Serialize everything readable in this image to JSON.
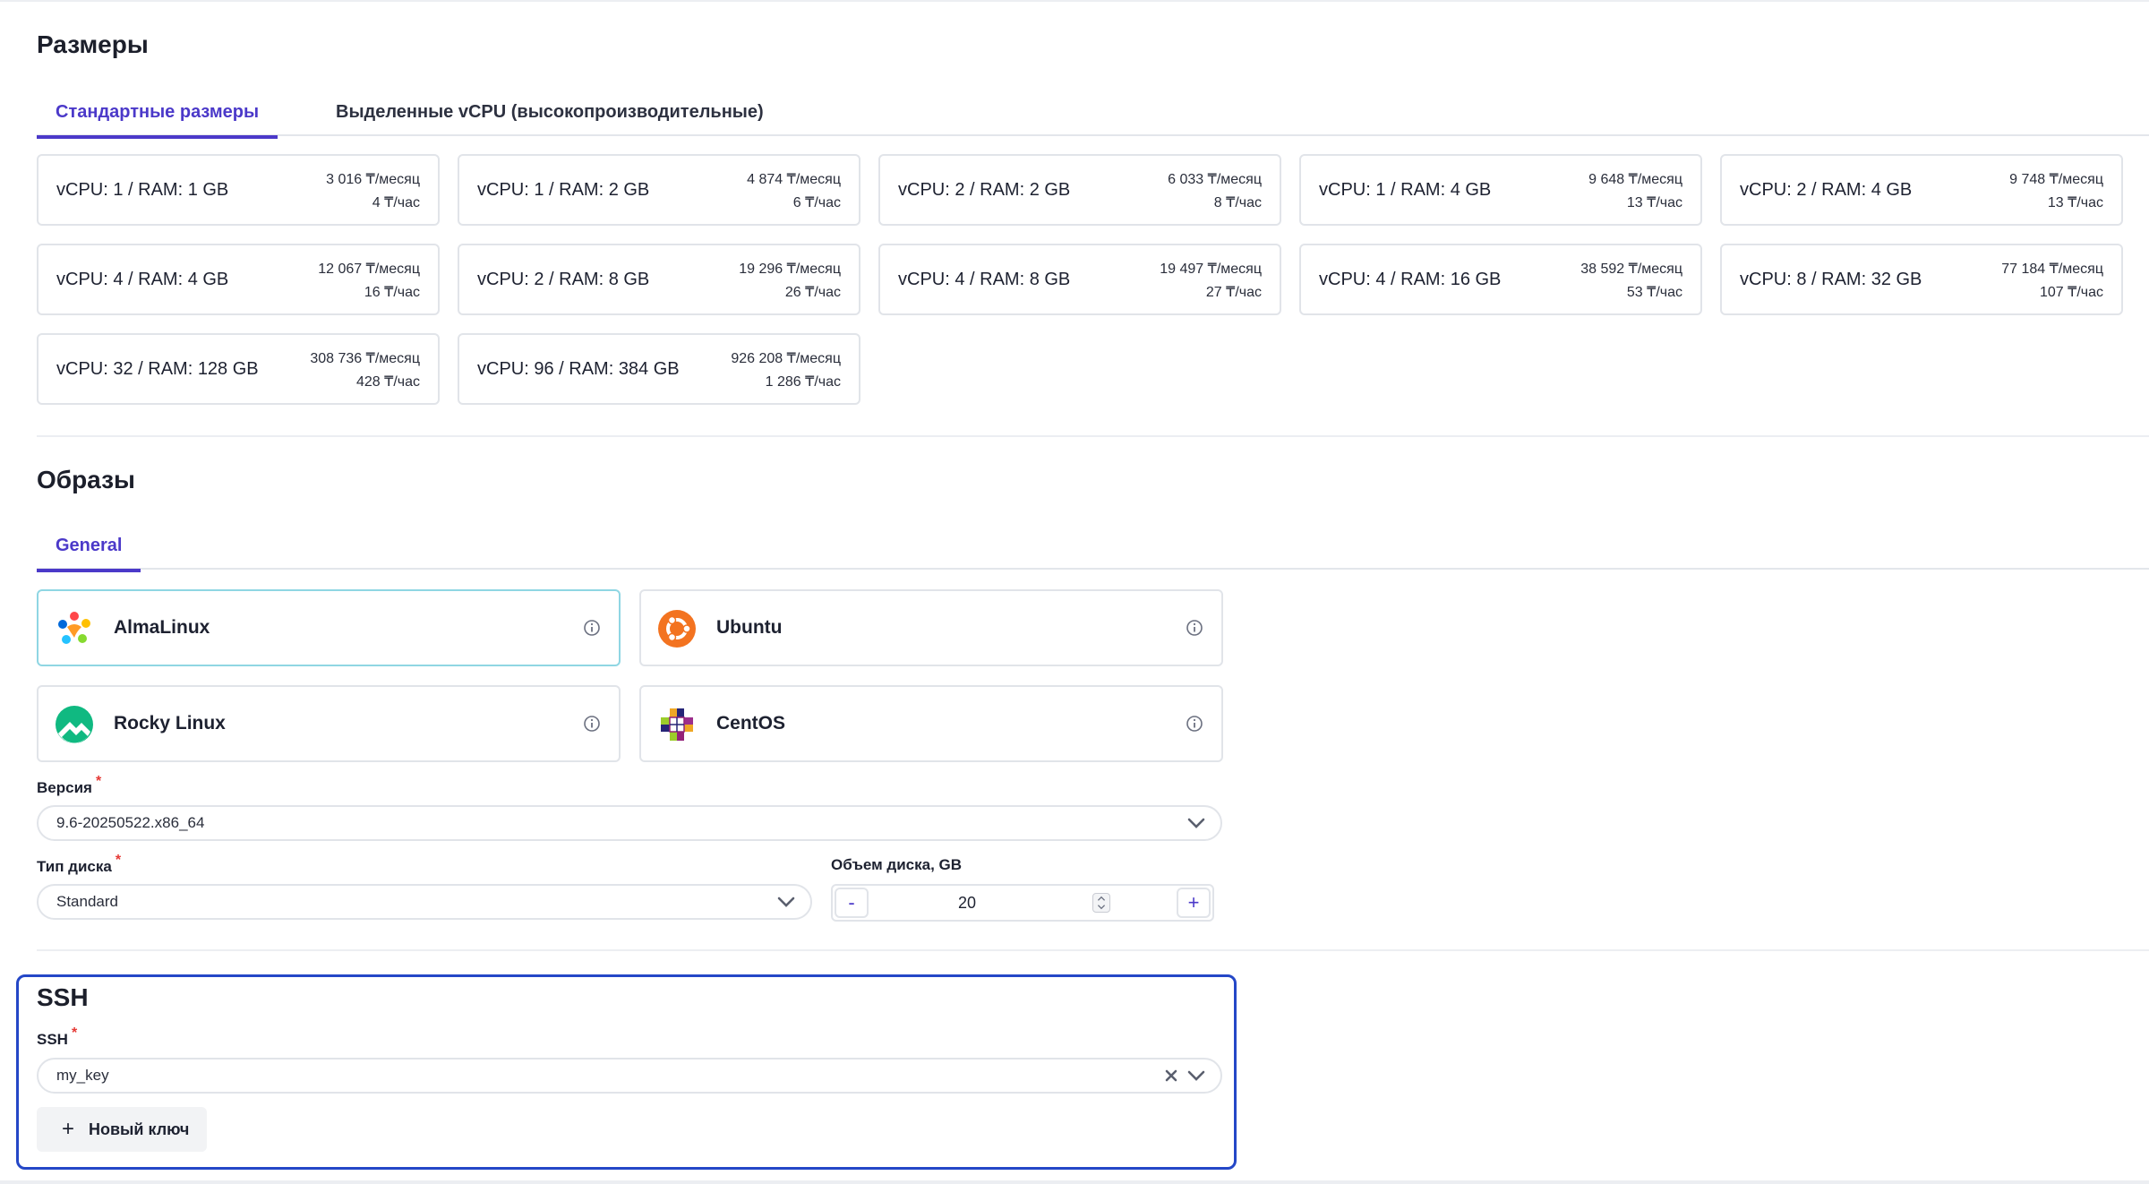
{
  "sizes": {
    "title": "Размеры",
    "tabs": [
      "Стандартные размеры",
      "Выделенные vCPU (высокопроизводительные)"
    ],
    "cards": [
      {
        "name": "vCPU: 1 / RAM: 1 GB",
        "monthly": "3 016 ₸/месяц",
        "hourly": "4 ₸/час"
      },
      {
        "name": "vCPU: 1 / RAM: 2 GB",
        "monthly": "4 874 ₸/месяц",
        "hourly": "6 ₸/час"
      },
      {
        "name": "vCPU: 2 / RAM: 2 GB",
        "monthly": "6 033 ₸/месяц",
        "hourly": "8 ₸/час"
      },
      {
        "name": "vCPU: 1 / RAM: 4 GB",
        "monthly": "9 648 ₸/месяц",
        "hourly": "13 ₸/час"
      },
      {
        "name": "vCPU: 2 / RAM: 4 GB",
        "monthly": "9 748 ₸/месяц",
        "hourly": "13 ₸/час"
      },
      {
        "name": "vCPU: 4 / RAM: 4 GB",
        "monthly": "12 067 ₸/месяц",
        "hourly": "16 ₸/час"
      },
      {
        "name": "vCPU: 2 / RAM: 8 GB",
        "monthly": "19 296 ₸/месяц",
        "hourly": "26 ₸/час"
      },
      {
        "name": "vCPU: 4 / RAM: 8 GB",
        "monthly": "19 497 ₸/месяц",
        "hourly": "27 ₸/час"
      },
      {
        "name": "vCPU: 4 / RAM: 16 GB",
        "monthly": "38 592 ₸/месяц",
        "hourly": "53 ₸/час"
      },
      {
        "name": "vCPU: 8 / RAM: 32 GB",
        "monthly": "77 184 ₸/месяц",
        "hourly": "107 ₸/час"
      },
      {
        "name": "vCPU: 32 / RAM: 128 GB",
        "monthly": "308 736 ₸/месяц",
        "hourly": "428 ₸/час"
      },
      {
        "name": "vCPU: 96 / RAM: 384 GB",
        "monthly": "926 208 ₸/месяц",
        "hourly": "1 286 ₸/час"
      }
    ]
  },
  "images": {
    "title": "Образы",
    "tabs": [
      "General"
    ],
    "items": [
      {
        "label": "AlmaLinux",
        "icon": "almalinux-logo-icon",
        "selected": true
      },
      {
        "label": "Ubuntu",
        "icon": "ubuntu-logo-icon",
        "selected": false
      },
      {
        "label": "Rocky Linux",
        "icon": "rocky-linux-logo-icon",
        "selected": false
      },
      {
        "label": "CentOS",
        "icon": "centos-logo-icon",
        "selected": false
      }
    ],
    "version": {
      "label": "Версия",
      "required": "*",
      "value": "9.6-20250522.x86_64"
    },
    "disk_type": {
      "label": "Тип диска",
      "required": "*",
      "value": "Standard"
    },
    "disk_size": {
      "label": "Объем диска, GB",
      "value": "20",
      "minus": "-",
      "plus": "+"
    }
  },
  "ssh": {
    "title": "SSH",
    "label": "SSH",
    "required": "*",
    "value": "my_key",
    "new_key_button": "Новый ключ",
    "new_key_icon": "+"
  },
  "colors": {
    "accent": "#4b39c9",
    "selected_border": "#8fd6e3",
    "focus_border": "#2447c7",
    "required": "#e53935"
  }
}
